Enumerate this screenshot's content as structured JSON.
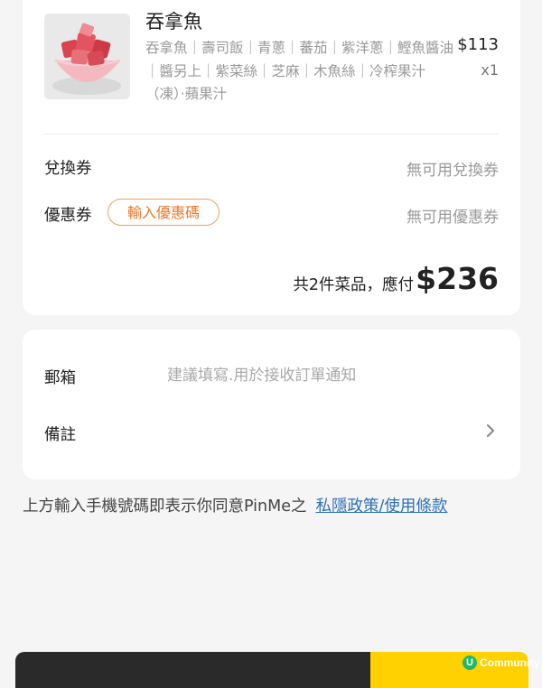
{
  "order_item": {
    "name": "吞拿魚",
    "description": "吞拿魚｜壽司飯｜青蔥｜蕃茄｜紫洋蔥｜鰹魚醬油｜醬另上｜紫菜絲｜芝麻｜木魚絲｜冷榨果汁 （凍）‧蘋果汁",
    "price": "$113",
    "quantity": "x1",
    "thumbnail_icon": "tuna-cubes-bowl-photo"
  },
  "voucher": {
    "label": "兌換券",
    "value": "無可用兌換券"
  },
  "coupon": {
    "label": "優惠券",
    "button_label": "輸入優惠碼",
    "value": "無可用優惠券"
  },
  "total": {
    "summary": "共2件菜品，應付",
    "amount": "$236"
  },
  "contact": {
    "email_label": "郵箱",
    "email_value": "",
    "email_placeholder": "建議填寫.用於接收訂單通知",
    "note_label": "備註",
    "note_icon": "chevron-right-icon"
  },
  "agreement": {
    "text": "上方輸入手機號碼即表示你同意PinMe之",
    "link_label": "私隱政策/使用條款"
  },
  "watermark": {
    "badge": "U",
    "label": "Community"
  },
  "colors": {
    "accent_orange": "#e8782b",
    "link_blue": "#2e6fb5",
    "bar_dark": "#2a2a2a",
    "bar_yellow": "#ffd100"
  }
}
